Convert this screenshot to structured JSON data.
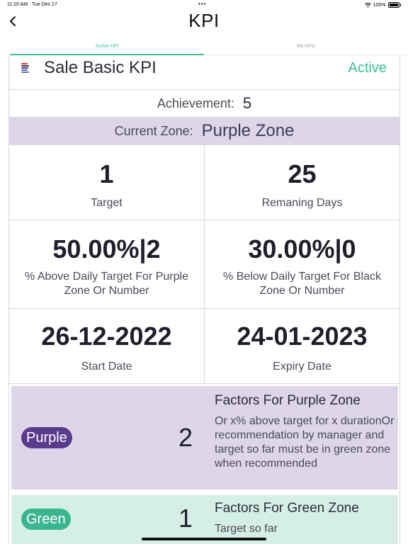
{
  "status_bar": {
    "time": "11:20 AM",
    "date": "Tue Dec 27",
    "battery": "100%"
  },
  "nav": {
    "title": "KPI",
    "back_icon": "chevron-left-icon"
  },
  "tabs": [
    {
      "label": "Active KPI",
      "active": true
    },
    {
      "label": "My KPIs",
      "active": false
    }
  ],
  "kpi": {
    "name": "Sale Basic KPI",
    "status": "Active",
    "achievement_label": "Achievement:",
    "achievement_value": "5",
    "zone_label": "Current Zone:",
    "zone_value": "Purple Zone"
  },
  "stats": [
    {
      "value": "1",
      "label": "Target"
    },
    {
      "value": "25",
      "label": "Remaning Days"
    },
    {
      "value": "50.00%|2",
      "label": "% Above Daily Target For Purple Zone Or Number"
    },
    {
      "value": "30.00%|0",
      "label": "% Below Daily Target For Black Zone Or Number"
    },
    {
      "value": "26-12-2022",
      "label": "Start Date"
    },
    {
      "value": "24-01-2023",
      "label": "Expiry Date"
    }
  ],
  "factors": [
    {
      "zone": "Purple",
      "count": "2",
      "title": "Factors For Purple Zone",
      "description": "Or x% above target for x durationOr recommendation by manager and target so far must be in green zone when recommended",
      "color": "#5a3a8c",
      "background": "#dcd6e8"
    },
    {
      "zone": "Green",
      "count": "1",
      "title": "Factors For Green Zone",
      "description": "Target so far",
      "color": "#3bb58f",
      "background": "#d6efe6"
    }
  ],
  "colors": {
    "accent": "#3bbf93",
    "purple_zone": "#dcd6e8",
    "green_zone": "#d6efe6"
  }
}
